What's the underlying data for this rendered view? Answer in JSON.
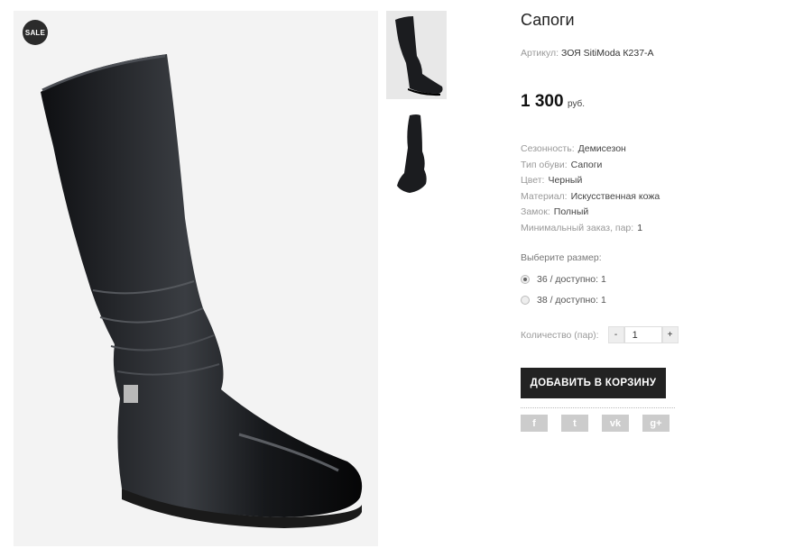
{
  "badge": {
    "label": "SALE"
  },
  "product": {
    "title": "Сапоги",
    "sku_label": "Артикул:",
    "sku_value": "ЗОЯ SitiModa К237-А",
    "price_amount": "1 300",
    "price_currency": "руб."
  },
  "properties": [
    {
      "label": "Сезонность:",
      "value": "Демисезон"
    },
    {
      "label": "Тип обуви:",
      "value": "Сапоги"
    },
    {
      "label": "Цвет:",
      "value": "Черный"
    },
    {
      "label": "Материал:",
      "value": "Искусственная кожа"
    },
    {
      "label": "Замок:",
      "value": "Полный"
    },
    {
      "label": "Минимальный заказ, пар:",
      "value": "1"
    }
  ],
  "sizes": {
    "title": "Выберите размер:",
    "options": [
      {
        "label": "36 / доступно: 1",
        "selected": true
      },
      {
        "label": "38 / доступно: 1",
        "selected": false
      }
    ]
  },
  "quantity": {
    "label": "Количество (пар):",
    "minus": "-",
    "value": "1",
    "plus": "+"
  },
  "cart": {
    "add_label": "ДОБАВИТЬ В КОРЗИНУ"
  },
  "social": [
    {
      "icon": "facebook-icon",
      "glyph": "f"
    },
    {
      "icon": "twitter-icon",
      "glyph": "t"
    },
    {
      "icon": "vk-icon",
      "glyph": "vk"
    },
    {
      "icon": "google-plus-icon",
      "glyph": "g+"
    }
  ],
  "colors": {
    "accent": "#222222",
    "muted": "#999999",
    "social_bg": "#cccccc"
  }
}
